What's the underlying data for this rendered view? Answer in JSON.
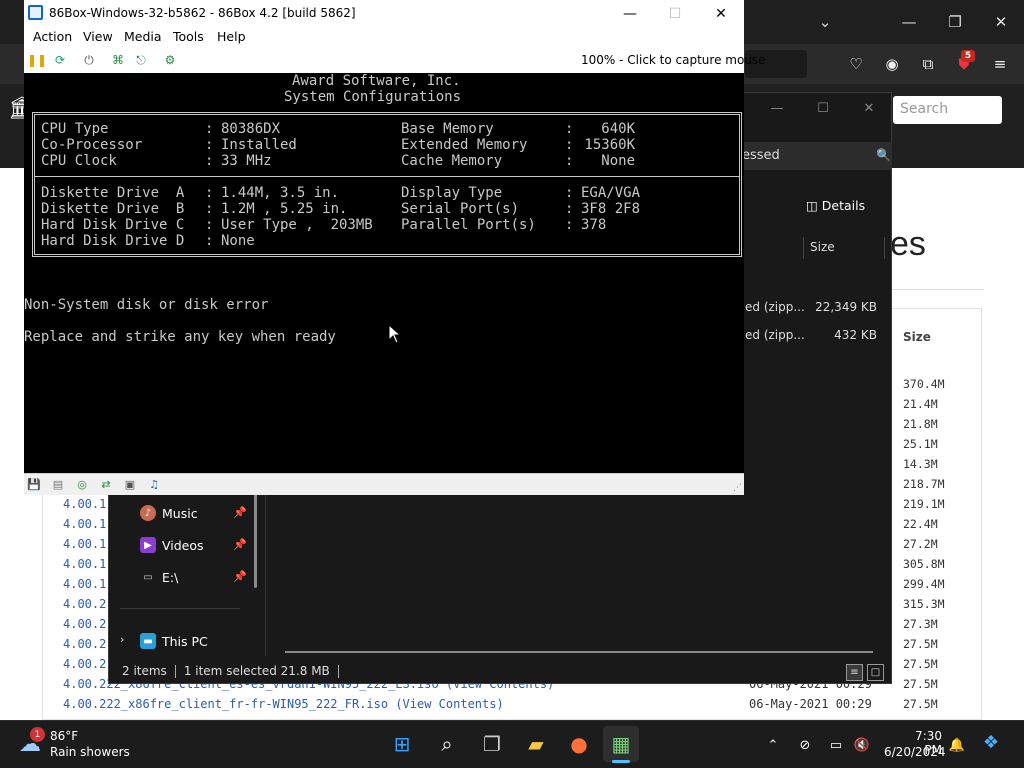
{
  "browser": {
    "search_placeholder": "Search",
    "heading": "es",
    "extension_badge": "5",
    "listing": {
      "size_header": "Size",
      "sizes": [
        "370.4M",
        "21.4M",
        "21.8M",
        "25.1M",
        "14.3M",
        "218.7M",
        "219.1M",
        "22.4M",
        "27.2M",
        "305.8M",
        "299.4M",
        "315.3M",
        "27.3M",
        "27.5M",
        "27.5M",
        "27.5M",
        "27.5M"
      ],
      "rows": [
        {
          "name": "4.00.1",
          "date": ""
        },
        {
          "name": "4.00.1",
          "date": ""
        },
        {
          "name": "4.00.1",
          "date": ""
        },
        {
          "name": "4.00.1",
          "date": ""
        },
        {
          "name": "4.00.1",
          "date": ""
        },
        {
          "name": "4.00.2",
          "date": ""
        },
        {
          "name": "4.00.2",
          "date": ""
        },
        {
          "name": "4.00.2",
          "date": ""
        },
        {
          "name": "4.00.2",
          "date": ""
        },
        {
          "name": "4.00.222_x86fre_client_es-es_vrdah1-WIN95_222_ES.iso (View Contents)",
          "date": "06-May-2021 00:29"
        },
        {
          "name": "4.00.222_x86fre_client_fr-fr-WIN95_222_FR.iso (View Contents)",
          "date": "06-May-2021 00:29"
        }
      ]
    }
  },
  "explorer": {
    "search_value": "essed",
    "details_label": "Details",
    "size_header": "Size",
    "files": [
      {
        "type": "ed (zipp...",
        "size": "22,349 KB"
      },
      {
        "type": "ed (zipp...",
        "size": "432 KB"
      }
    ],
    "nav": [
      {
        "label": "Music"
      },
      {
        "label": "Videos"
      },
      {
        "label": "E:\\"
      },
      {
        "label": "This PC"
      }
    ],
    "status": {
      "items": "2 items",
      "selected": "1 item selected",
      "selected_size": "21.8 MB"
    }
  },
  "box86": {
    "title": "86Box-Windows-32-b5862 - 86Box 4.2 [build 5862]",
    "menu": [
      "Action",
      "View",
      "Media",
      "Tools",
      "Help"
    ],
    "capture_status": "100% - Click to capture mouse",
    "bios": {
      "vendor": "Award Software, Inc.",
      "heading": "System Configurations",
      "left_top": [
        {
          "label": "CPU Type",
          "value": "80386DX"
        },
        {
          "label": "Co-Processor",
          "value": "Installed"
        },
        {
          "label": "CPU Clock",
          "value": "33 MHz"
        }
      ],
      "right_top": [
        {
          "label": "Base Memory",
          "value": "640K"
        },
        {
          "label": "Extended Memory",
          "value": "15360K"
        },
        {
          "label": "Cache Memory",
          "value": "None"
        }
      ],
      "left_bottom": [
        {
          "label": "Diskette Drive  A",
          "value": "1.44M, 3.5 in."
        },
        {
          "label": "Diskette Drive  B",
          "value": "1.2M , 5.25 in."
        },
        {
          "label": "Hard Disk Drive C",
          "value": "User Type ,  203MB"
        },
        {
          "label": "Hard Disk Drive D",
          "value": "None"
        }
      ],
      "right_bottom": [
        {
          "label": "Display Type",
          "value": "EGA/VGA"
        },
        {
          "label": "Serial Port(s)",
          "value": "3F8 2F8"
        },
        {
          "label": "Parallel Port(s)",
          "value": "378"
        }
      ],
      "error_line1": "Non-System disk or disk error",
      "error_line2": "Replace and strike any key when ready"
    }
  },
  "taskbar": {
    "weather_temp": "86°F",
    "weather_desc": "Rain showers",
    "weather_badge": "1",
    "time": "7:30 PM",
    "date": "6/20/2024",
    "accent": "#4cc2ff"
  }
}
